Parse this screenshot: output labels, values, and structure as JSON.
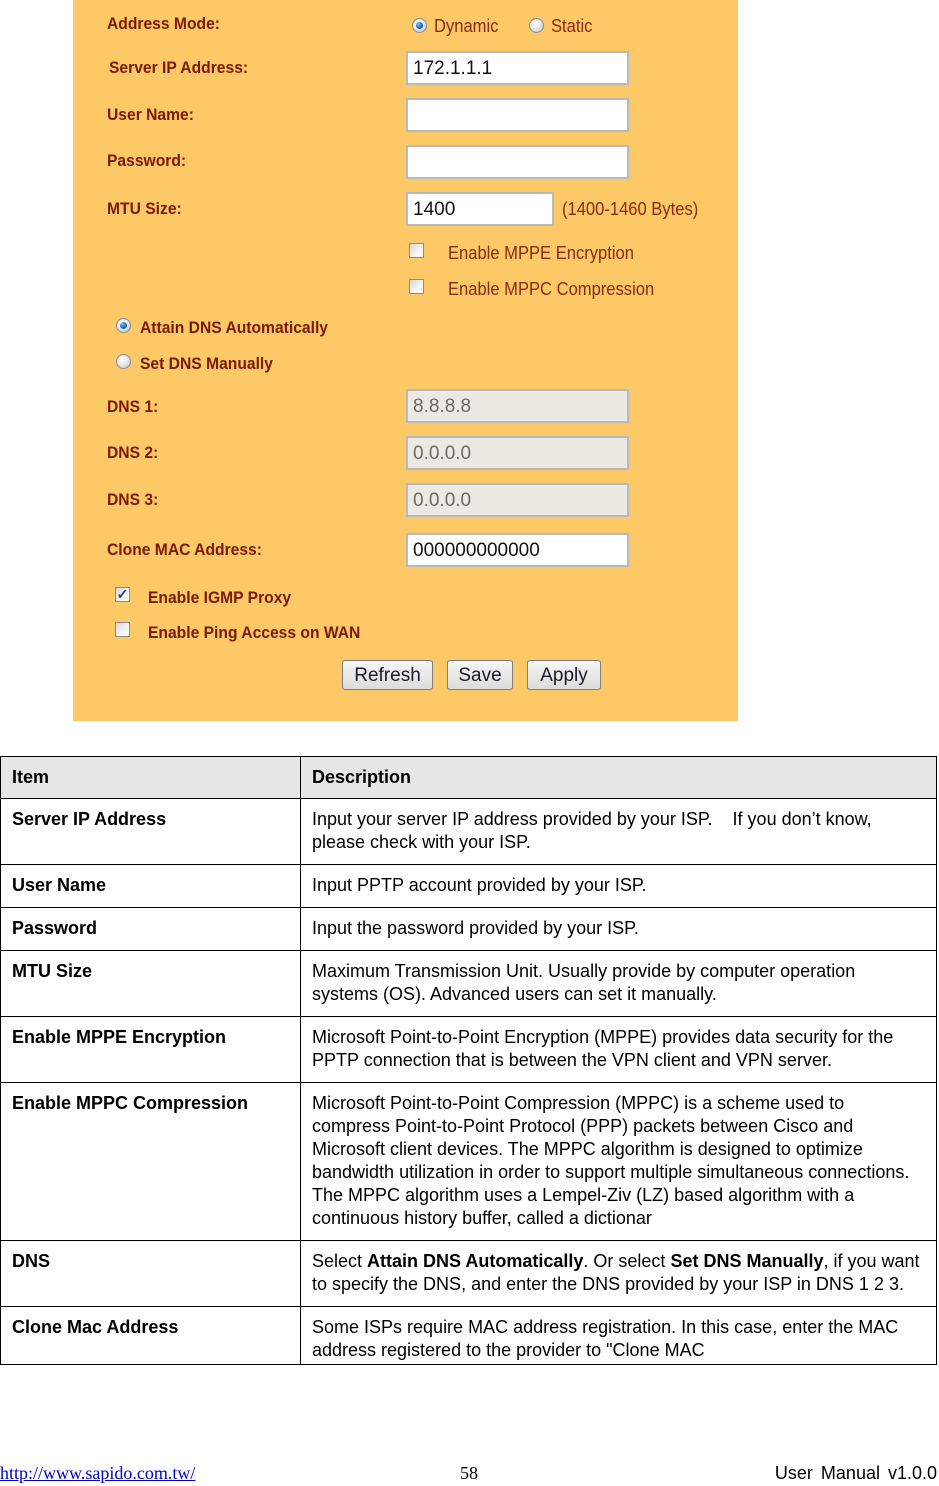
{
  "settings": {
    "address_mode": {
      "label": "Address Mode:",
      "options": [
        {
          "label": "Dynamic",
          "selected": true
        },
        {
          "label": "Static",
          "selected": false
        }
      ]
    },
    "server_ip": {
      "label": "Server IP Address:",
      "value": "172.1.1.1"
    },
    "user_name": {
      "label": "User Name:",
      "value": ""
    },
    "password": {
      "label": "Password:",
      "value": ""
    },
    "mtu": {
      "label": "MTU Size:",
      "value": "1400",
      "hint": "(1400-1460 Bytes)"
    },
    "mppe": {
      "label": "Enable MPPE Encryption",
      "checked": false
    },
    "mppc": {
      "label": "Enable MPPC Compression",
      "checked": false
    },
    "dns_mode": {
      "options": [
        {
          "label": "Attain DNS Automatically",
          "selected": true
        },
        {
          "label": "Set DNS Manually",
          "selected": false
        }
      ]
    },
    "dns1": {
      "label": "DNS 1:",
      "value": "8.8.8.8",
      "disabled": true
    },
    "dns2": {
      "label": "DNS 2:",
      "value": "0.0.0.0",
      "disabled": true
    },
    "dns3": {
      "label": "DNS 3:",
      "value": "0.0.0.0",
      "disabled": true
    },
    "clone_mac": {
      "label": "Clone MAC Address:",
      "value": "000000000000"
    },
    "igmp_proxy": {
      "label": "Enable IGMP Proxy",
      "checked": true
    },
    "ping_wan": {
      "label": "Enable Ping Access on WAN",
      "checked": false
    },
    "buttons": {
      "refresh": "Refresh",
      "save": "Save",
      "apply": "Apply"
    },
    "check_glyph": "✓",
    "colors": {
      "panel_bg": "#fdc967",
      "label": "#7a1a05",
      "header_bg": "#e6e6e6"
    }
  },
  "table": {
    "headers": {
      "item": "Item",
      "description": "Description"
    },
    "rows": [
      {
        "item": "Server IP Address",
        "description": "Input your server IP address provided by your ISP.    If you don’t know, please check with your ISP."
      },
      {
        "item": "User Name",
        "description": "Input PPTP account provided by your ISP."
      },
      {
        "item": "Password",
        "description": "Input the password provided by your ISP."
      },
      {
        "item": "MTU Size",
        "description": "Maximum Transmission Unit. Usually provide by computer operation systems (OS). Advanced users can set it manually."
      },
      {
        "item": "Enable MPPE Encryption",
        "description": "Microsoft Point-to-Point Encryption (MPPE) provides data security for the PPTP connection that is between the VPN client and VPN server."
      },
      {
        "item": "Enable MPPC Compression",
        "description": "Microsoft Point-to-Point Compression (MPPC) is a scheme used to compress Point-to-Point Protocol (PPP) packets between Cisco and Microsoft client devices. The MPPC algorithm is designed to optimize bandwidth utilization in order to support multiple simultaneous connections. The MPPC algorithm uses a Lempel-Ziv (LZ) based algorithm with a continuous history buffer, called a dictionar"
      },
      {
        "item": "DNS",
        "description_parts": [
          {
            "text": "Select ",
            "bold": false
          },
          {
            "text": "Attain DNS Automatically",
            "bold": true
          },
          {
            "text": ". Or select ",
            "bold": false
          },
          {
            "text": "Set DNS Manually",
            "bold": true
          },
          {
            "text": ", if you want to specify the DNS, and enter the DNS provided by your ISP in DNS 1 2 3.",
            "bold": false
          }
        ]
      },
      {
        "item": "Clone Mac Address",
        "description": "Some ISPs require MAC address registration. In this case, enter the MAC address registered to the provider to \"Clone MAC"
      }
    ]
  },
  "footer": {
    "url": "http://www.sapido.com.tw/",
    "page_number": "58",
    "version": "User  Manual  v1.0.0"
  }
}
